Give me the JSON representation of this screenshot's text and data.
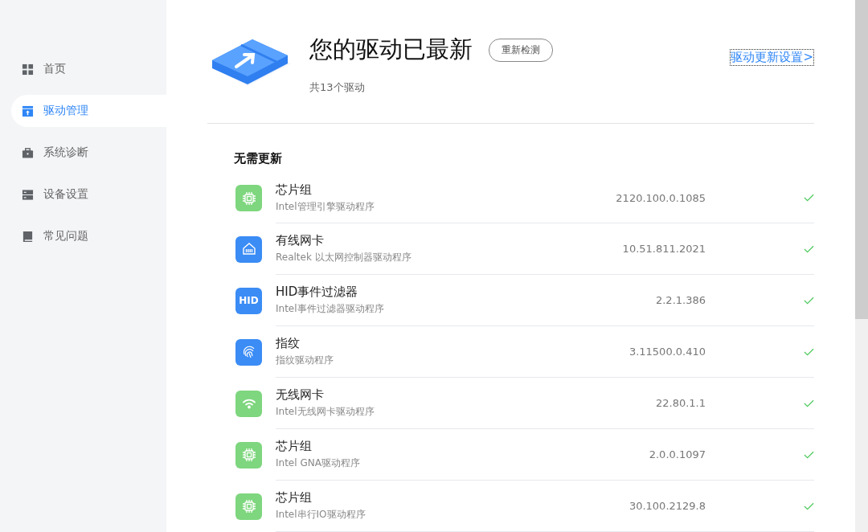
{
  "sidebar": {
    "items": [
      {
        "label": "首页",
        "kind": "grid",
        "selected": false
      },
      {
        "label": "驱动管理",
        "kind": "upload",
        "selected": true
      },
      {
        "label": "系统诊断",
        "kind": "case",
        "selected": false
      },
      {
        "label": "设备设置",
        "kind": "server",
        "selected": false
      },
      {
        "label": "常见问题",
        "kind": "book",
        "selected": false
      }
    ]
  },
  "header": {
    "title": "您的驱动已最新",
    "recheck_button": "重新检测",
    "summary": "共13个驱动",
    "settings_link": "驱动更新设置>"
  },
  "section": {
    "title": "无需更新",
    "drivers": [
      {
        "name": "芯片组",
        "description": "Intel管理引擎驱动程序",
        "version": "2120.100.0.1085",
        "kind": "chip",
        "color": "#7ed67e"
      },
      {
        "name": "有线网卡",
        "description": "Realtek 以太网控制器驱动程序",
        "version": "10.51.811.2021",
        "kind": "ethernet",
        "color": "#3b8cf5"
      },
      {
        "name": "HID事件过滤器",
        "description": "Intel事件过滤器驱动程序",
        "version": "2.2.1.386",
        "kind": "text",
        "icon_text": "HID",
        "color": "#3b8cf5"
      },
      {
        "name": "指纹",
        "description": "指纹驱动程序",
        "version": "3.11500.0.410",
        "kind": "fingerprint",
        "color": "#3b8cf5"
      },
      {
        "name": "无线网卡",
        "description": "Intel无线网卡驱动程序",
        "version": "22.80.1.1",
        "kind": "wifi",
        "color": "#7ed67e"
      },
      {
        "name": "芯片组",
        "description": "Intel GNA驱动程序",
        "version": "2.0.0.1097",
        "kind": "chip",
        "color": "#7ed67e"
      },
      {
        "name": "芯片组",
        "description": "Intel串行IO驱动程序",
        "version": "30.100.2129.8",
        "kind": "chip",
        "color": "#7ed67e"
      }
    ]
  }
}
